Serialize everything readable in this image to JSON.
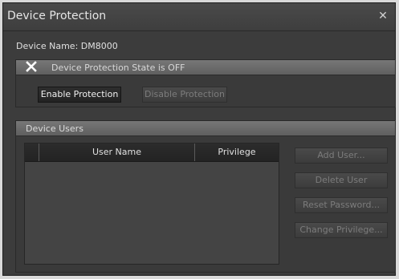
{
  "window": {
    "title": "Device Protection"
  },
  "device": {
    "label": "Device Name:",
    "name": "DM8000"
  },
  "protection": {
    "state_text": "Device Protection State is OFF",
    "enable_label": "Enable Protection",
    "disable_label": "Disable Protection"
  },
  "users": {
    "section_title": "Device Users",
    "columns": [
      "User Name",
      "Privilege"
    ],
    "rows": [],
    "actions": {
      "add": "Add User...",
      "delete": "Delete User",
      "reset": "Reset Password...",
      "change": "Change Privilege..."
    }
  },
  "icons": {
    "close": "close-icon",
    "state": "x-mark-icon"
  },
  "colors": {
    "background": "#3c3c3c",
    "header": "#6b6b6b",
    "text": "#d6d6d6"
  }
}
